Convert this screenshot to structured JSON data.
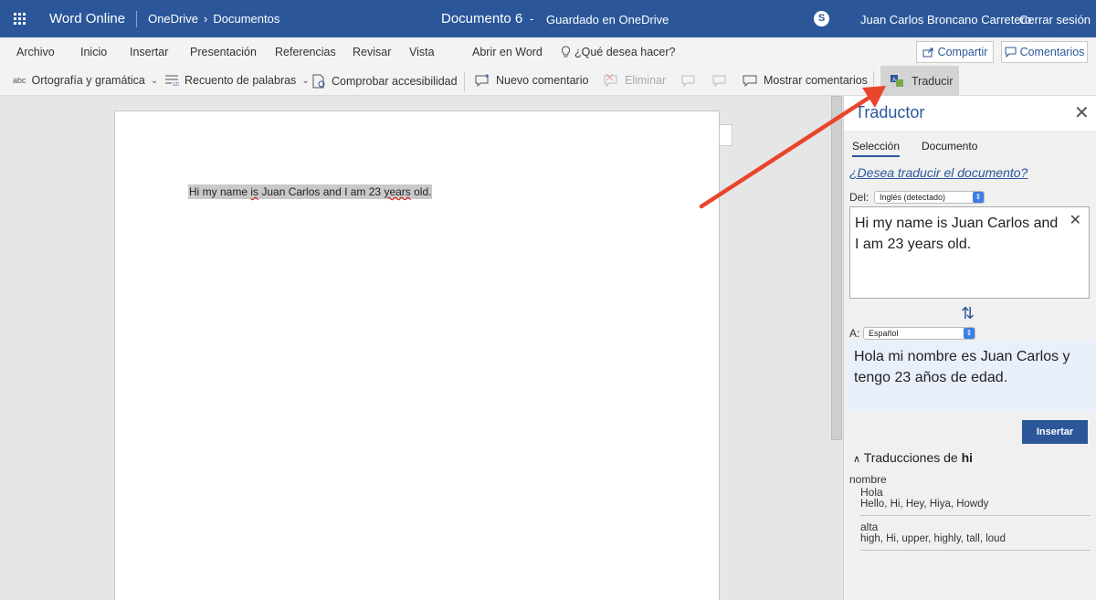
{
  "titlebar": {
    "app_name": "Word Online",
    "breadcrumb_root": "OneDrive",
    "breadcrumb_sep": "›",
    "breadcrumb_folder": "Documentos",
    "doc_title": "Documento 6",
    "doc_dash": "-",
    "save_status": "Guardado en OneDrive",
    "user_name": "Juan Carlos Broncano Carretero",
    "sign_out": "Cerrar sesión",
    "skype_glyph": "S"
  },
  "menu": {
    "tabs": [
      "Archivo",
      "Inicio",
      "Insertar",
      "Presentación",
      "Referencias",
      "Revisar",
      "Vista",
      "Abrir en Word"
    ],
    "active_tab": "Revisar",
    "tell_me": "¿Qué desea hacer?",
    "share": "Compartir",
    "comments": "Comentarios"
  },
  "ribbon": {
    "spelling": "Ortografía y gramática",
    "word_count": "Recuento de palabras",
    "accessibility": "Comprobar accesibilidad",
    "new_comment": "Nuevo comentario",
    "delete": "Eliminar",
    "show_comments": "Mostrar comentarios",
    "translate": "Traducir",
    "spelling_icon_text": "abc"
  },
  "document": {
    "text_before": "Hi my name ",
    "text_sq1": "is",
    "text_mid": " Juan Carlos and I am 23 ",
    "text_sq2": "years",
    "text_after": " old."
  },
  "translator": {
    "title": "Traductor",
    "tab_selection": "Selección",
    "tab_document": "Documento",
    "translate_doc_link": "¿Desea traducir el documento?",
    "from_label": "Del:",
    "from_lang": "Inglés (detectado)",
    "source_text": "Hi my name is Juan Carlos and I am 23 years old.",
    "to_label": "A:",
    "to_lang": "Español",
    "result_text": "Hola mi nombre es Juan Carlos y tengo 23 años de edad.",
    "insert_button": "Insertar",
    "translations_heading": "Traducciones de",
    "translations_word": "hi",
    "part_of_speech": "nombre",
    "entries": [
      {
        "word": "Hola",
        "synonyms": "Hello, Hi, Hey, Hiya, Howdy"
      },
      {
        "word": "alta",
        "synonyms": "high, Hi, upper, highly, tall, loud"
      }
    ]
  },
  "colors": {
    "brand": "#2b579a",
    "arrow": "#e8452c",
    "result_bg": "#e9f0fb"
  }
}
